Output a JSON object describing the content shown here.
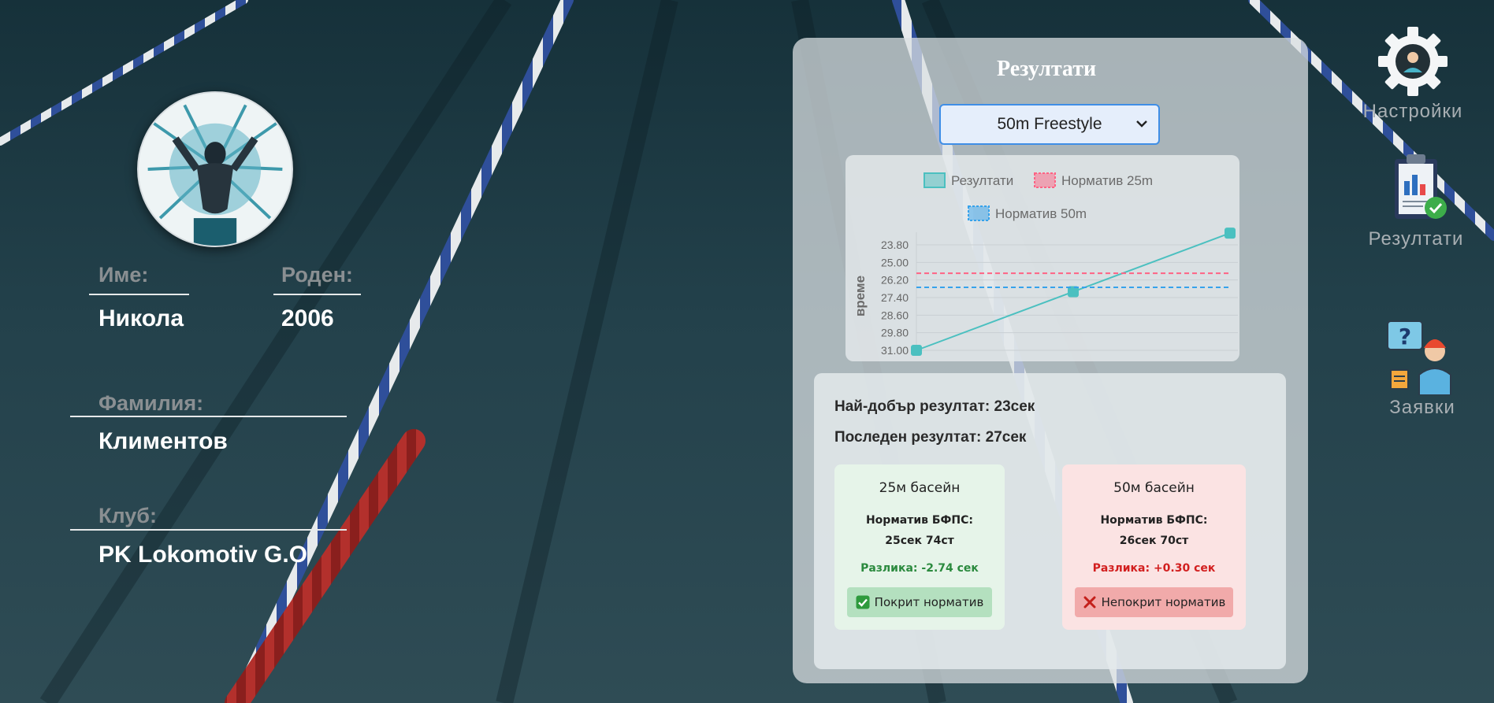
{
  "profile": {
    "first_name_label": "Име:",
    "first_name": "Никола",
    "born_label": "Роден:",
    "born": "2006",
    "last_name_label": "Фамилия:",
    "last_name": "Климентов",
    "club_label": "Клуб:",
    "club": "PK Lokomotiv G.O"
  },
  "results_panel": {
    "title": "Резултати",
    "event_select": {
      "value": "50m Freestyle",
      "options": [
        "50m Freestyle"
      ]
    }
  },
  "chart_data": {
    "type": "line",
    "legend": [
      "Резултати",
      "Норматив 25m",
      "Норматив 50m"
    ],
    "ylabel": "време",
    "yticks": [
      "23.80",
      "25.00",
      "26.20",
      "27.40",
      "28.60",
      "29.80",
      "31.00"
    ],
    "ylim": [
      31.0,
      23.8
    ],
    "y_reversed": true,
    "grid": true,
    "legend_position": "top",
    "series": [
      {
        "name": "Резултати",
        "values": [
          31.0,
          27.0,
          23.0
        ],
        "color": "#4bc0c0",
        "style": "solid"
      },
      {
        "name": "Норматив 25m",
        "values": [
          25.74,
          25.74,
          25.74
        ],
        "color": "#ff6384",
        "style": "dashed"
      },
      {
        "name": "Норматив 50m",
        "values": [
          26.7,
          26.7,
          26.7
        ],
        "color": "#36a2eb",
        "style": "dashed"
      }
    ]
  },
  "stats": {
    "best": "Най-добър резултат: 23сек",
    "last": "Последен резултат: 27сек"
  },
  "pool25": {
    "title": "25м басейн",
    "norm_label": "Норматив БФПС:",
    "norm_value": "25сек 74ст",
    "diff": "Разлика: -2.74 сек",
    "status": "Покрит норматив"
  },
  "pool50": {
    "title": "50м басейн",
    "norm_label": "Норматив БФПС:",
    "norm_value": "26сек 70ст",
    "diff": "Разлика: +0.30 сек",
    "status": "Непокрит норматив"
  },
  "nav": {
    "settings": {
      "label": "Настройки",
      "icon": "gear-icon"
    },
    "results": {
      "label": "Резултати",
      "icon": "clipboard-chart-icon"
    },
    "requests": {
      "label": "Заявки",
      "icon": "support-agent-icon"
    }
  },
  "colors": {
    "pool_bg": "#1e3a44",
    "accent_teal": "#4bc0c0",
    "norm25": "#ff6384",
    "norm50": "#36a2eb"
  }
}
